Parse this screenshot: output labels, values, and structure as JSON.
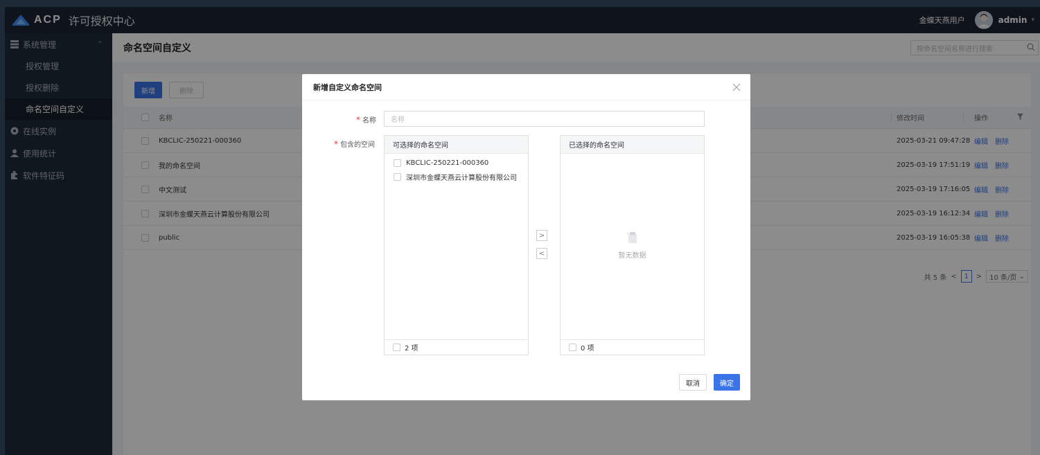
{
  "app": {
    "logo_text": "ACP",
    "title": "许可授权中心"
  },
  "header": {
    "tenant": "金蝶天燕用户",
    "username": "admin"
  },
  "sidebar": {
    "groups": [
      {
        "label": "系统管理",
        "icon": "grid-icon",
        "children": [
          "授权管理",
          "授权删除",
          "命名空间自定义"
        ],
        "active_child": "命名空间自定义"
      },
      {
        "label": "在线实例",
        "icon": "cloud-icon"
      },
      {
        "label": "使用统计",
        "icon": "users-icon"
      },
      {
        "label": "软件特征码",
        "icon": "puzzle-icon"
      }
    ]
  },
  "page": {
    "title": "命名空间自定义",
    "search_placeholder": "按命名空间名称进行搜索"
  },
  "toolbar": {
    "add_label": "新增",
    "delete_label": "删除"
  },
  "table": {
    "columns": {
      "name": "名称",
      "modified": "修改时间",
      "ops": "操作"
    },
    "rows": [
      {
        "name": "KBCLIC-250221-000360",
        "modified": "2025-03-21 09:47:28"
      },
      {
        "name": "我的命名空间",
        "modified": "2025-03-19 17:51:19"
      },
      {
        "name": "中文测试",
        "modified": "2025-03-19 17:16:05"
      },
      {
        "name": "深圳市金蝶天燕云计算股份有限公司",
        "modified": "2025-03-19 16:12:34"
      },
      {
        "name": "public",
        "modified": "2025-03-19 16:05:38"
      }
    ],
    "edit_label": "编辑",
    "delete_label": "删除"
  },
  "pagination": {
    "total": "共 5 条",
    "prev": "<",
    "current": "1",
    "next": ">",
    "page_size": "10 条/页"
  },
  "modal": {
    "title": "新增自定义命名空间",
    "name_label": "名称",
    "name_placeholder": "名称",
    "include_label": "包含的空间",
    "left_panel": {
      "title": "可选择的命名空间",
      "items": [
        "KBCLIC-250221-000360",
        "深圳市金蝶天燕云计算股份有限公司"
      ],
      "count": "2 项"
    },
    "right_panel": {
      "title": "已选择的命名空间",
      "empty_text": "暂无数据",
      "count": "0 项"
    },
    "move_right": ">",
    "move_left": "<",
    "cancel_label": "取消",
    "ok_label": "确定"
  },
  "colors": {
    "accent": "#3b74e8",
    "topbar": "#1c2633",
    "sidebar": "#1f2a38",
    "required": "#e4393c"
  }
}
